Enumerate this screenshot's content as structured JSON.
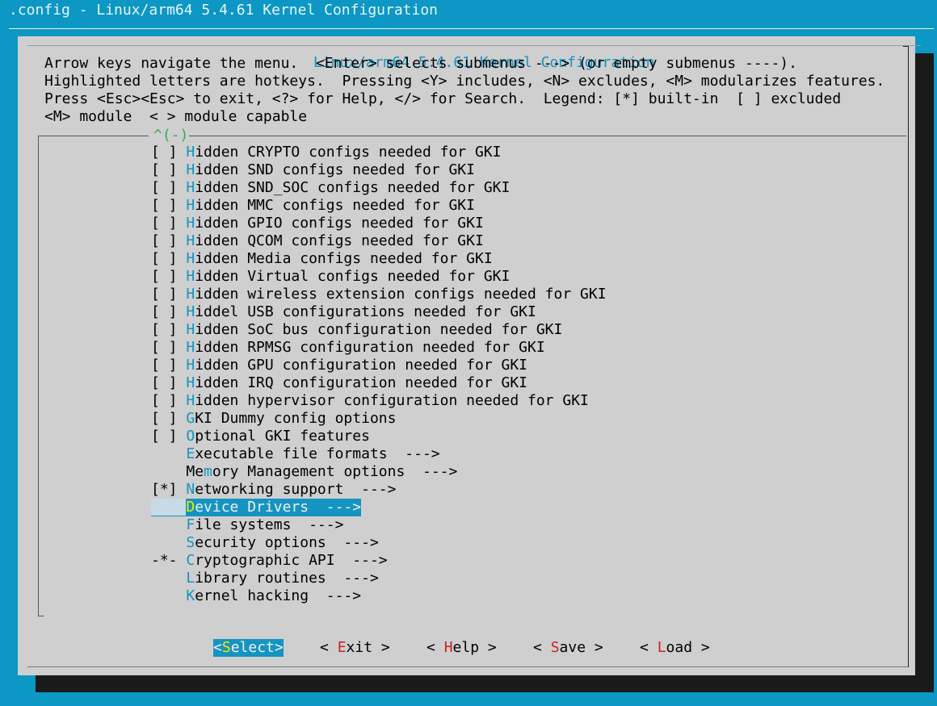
{
  "window_title": ".config - Linux/arm64 5.4.61 Kernel Configuration",
  "dialog_title": "Linux/arm64 5.4.61 Kernel Configuration",
  "help_lines": [
    "Arrow keys navigate the menu.  <Enter> selects submenus ---> (or empty submenus ----).",
    "Highlighted letters are hotkeys.  Pressing <Y> includes, <N> excludes, <M> modularizes features.",
    "Press <Esc><Esc> to exit, <?> for Help, </> for Search.  Legend: [*] built-in  [ ] excluded",
    "<M> module  < > module capable"
  ],
  "scroll_indicator": "^(-)",
  "menu_items": [
    {
      "prefix": "[ ] ",
      "hotkey": "H",
      "rest": "idden CRYPTO configs needed for GKI"
    },
    {
      "prefix": "[ ] ",
      "hotkey": "H",
      "rest": "idden SND configs needed for GKI"
    },
    {
      "prefix": "[ ] ",
      "hotkey": "H",
      "rest": "idden SND_SOC configs needed for GKI"
    },
    {
      "prefix": "[ ] ",
      "hotkey": "H",
      "rest": "idden MMC configs needed for GKI"
    },
    {
      "prefix": "[ ] ",
      "hotkey": "H",
      "rest": "idden GPIO configs needed for GKI"
    },
    {
      "prefix": "[ ] ",
      "hotkey": "H",
      "rest": "idden QCOM configs needed for GKI"
    },
    {
      "prefix": "[ ] ",
      "hotkey": "H",
      "rest": "idden Media configs needed for GKI"
    },
    {
      "prefix": "[ ] ",
      "hotkey": "H",
      "rest": "idden Virtual configs needed for GKI"
    },
    {
      "prefix": "[ ] ",
      "hotkey": "H",
      "rest": "idden wireless extension configs needed for GKI"
    },
    {
      "prefix": "[ ] ",
      "hotkey": "H",
      "rest": "iddel USB configurations needed for GKI"
    },
    {
      "prefix": "[ ] ",
      "hotkey": "H",
      "rest": "idden SoC bus configuration needed for GKI"
    },
    {
      "prefix": "[ ] ",
      "hotkey": "H",
      "rest": "idden RPMSG configuration needed for GKI"
    },
    {
      "prefix": "[ ] ",
      "hotkey": "H",
      "rest": "idden GPU configuration needed for GKI"
    },
    {
      "prefix": "[ ] ",
      "hotkey": "H",
      "rest": "idden IRQ configuration needed for GKI"
    },
    {
      "prefix": "[ ] ",
      "hotkey": "H",
      "rest": "idden hypervisor configuration needed for GKI"
    },
    {
      "prefix": "[ ] ",
      "hotkey": "G",
      "rest": "KI Dummy config options"
    },
    {
      "prefix": "[ ] ",
      "hotkey": "O",
      "rest": "ptional GKI features"
    },
    {
      "prefix": "    ",
      "hotkey": "E",
      "rest": "xecutable file formats  --->"
    },
    {
      "prefix": "    ",
      "hotkey": "",
      "rest": "Me",
      "hotkey2": "m",
      "rest2": "ory Management options  --->"
    },
    {
      "prefix": "[*] ",
      "hotkey": "N",
      "rest": "etworking support  --->"
    },
    {
      "prefix": "    ",
      "hotkey": "D",
      "rest": "evice Drivers  --->",
      "selected": true
    },
    {
      "prefix": "    ",
      "hotkey": "F",
      "rest": "ile systems  --->"
    },
    {
      "prefix": "    ",
      "hotkey": "S",
      "rest": "ecurity options  --->"
    },
    {
      "prefix": "-*- ",
      "hotkey": "C",
      "rest": "ryptographic API  --->"
    },
    {
      "prefix": "    ",
      "hotkey": "L",
      "rest": "ibrary routines  --->"
    },
    {
      "prefix": "    ",
      "hotkey": "K",
      "rest": "ernel hacking  --->"
    }
  ],
  "buttons": [
    {
      "left": "<",
      "hotkey": "S",
      "rest": "elect>",
      "selected": true
    },
    {
      "left": "< ",
      "hotkey": "E",
      "rest": "xit >"
    },
    {
      "left": "< ",
      "hotkey": "H",
      "rest": "elp >"
    },
    {
      "left": "< ",
      "hotkey": "S",
      "rest": "ave >"
    },
    {
      "left": "< ",
      "hotkey": "L",
      "rest": "oad >"
    }
  ],
  "colors": {
    "terminal_bg": "#0c97c4",
    "dialog_bg": "#cfcfcf",
    "accent": "#1594c1",
    "selected_hotkey": "#f3e900",
    "button_hotkey": "#cc2222"
  }
}
